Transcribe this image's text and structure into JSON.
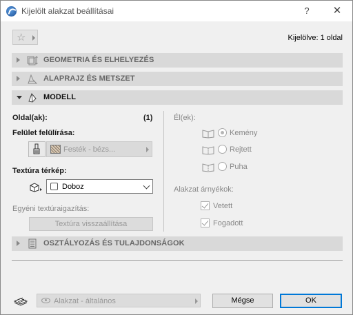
{
  "window": {
    "title": "Kijelölt alakzat beállításai",
    "help": "?",
    "close": "✕"
  },
  "header": {
    "selected_count": "Kijelölve: 1 oldal",
    "favorites_icon": "star-icon"
  },
  "sections": {
    "geometry": "GEOMETRIA ÉS ELHELYEZÉS",
    "plan_section": "ALAPRAJZ ÉS METSZET",
    "model": "MODELL",
    "classification": "OSZTÁLYOZÁS ÉS TULAJDONSÁGOK"
  },
  "model": {
    "sides_label": "Oldal(ak):",
    "sides_count": "(1)",
    "surface_override_label": "Felület felülírása:",
    "surface_value": "Festék - bézs...",
    "texture_map_label": "Textúra térkép:",
    "texture_map_value": "Doboz",
    "custom_texture_label": "Egyéni textúraigazítás:",
    "reset_texture_button": "Textúra visszaállítása",
    "edges_label": "Él(ek):",
    "edge_options": [
      "Kemény",
      "Rejtett",
      "Puha"
    ],
    "edge_selected": "Kemény",
    "shadows_label": "Alakzat árnyékok:",
    "cast_label": "Vetett",
    "received_label": "Fogadott",
    "cast_checked": true,
    "received_checked": true
  },
  "footer": {
    "layer_value": "Alakzat - általános",
    "cancel_label": "Mégse",
    "ok_label": "OK"
  },
  "colors": {
    "accent": "#0078d7",
    "section_bg": "#d9d9d9",
    "window_bg": "#f0f0f0"
  }
}
